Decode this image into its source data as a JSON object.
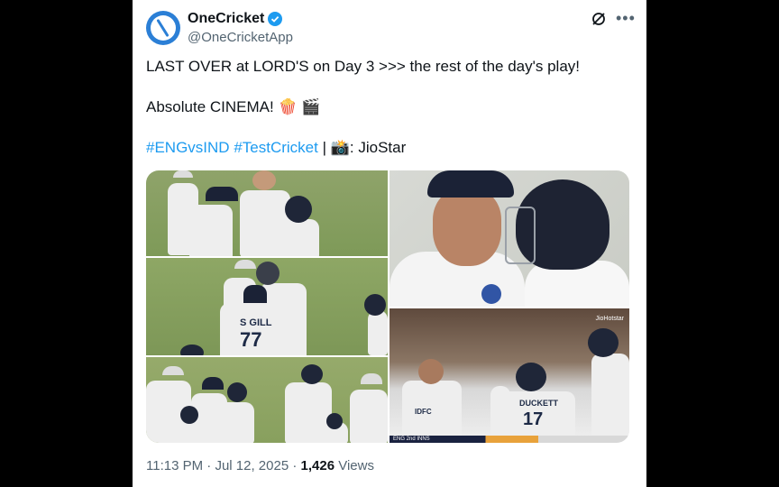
{
  "author": {
    "display_name": "OneCricket",
    "handle": "@OneCricketApp",
    "verified": true,
    "avatar_color": "#2b7fd6"
  },
  "icons": {
    "grok": "grok-icon",
    "more": "more-icon",
    "verified": "verified-badge-icon"
  },
  "tweet": {
    "line1": "LAST OVER at LORD'S on Day 3 >>> the rest of the day's play!",
    "line2_text": "Absolute CINEMA!",
    "line2_emoji": "🍿 🎬",
    "hashtag1": "#ENGvsIND",
    "hashtag2": "#TestCricket",
    "separator": "|",
    "camera_emoji": "📸",
    "credit": ": JioStar"
  },
  "media": {
    "jersey_gill": "S GILL",
    "jersey_gill_number": "77",
    "jersey_duckett": "DUCKETT",
    "jersey_duckett_number": "17",
    "broadcaster_mark": "JioHotstar",
    "score_label": "ENG 2nd INNS"
  },
  "meta": {
    "time": "11:13 PM",
    "date": "Jul 12, 2025",
    "dot": "·",
    "views_count": "1,426",
    "views_label": "Views"
  },
  "colors": {
    "link": "#1d9bf0",
    "text": "#0f1419",
    "secondary": "#536471"
  }
}
